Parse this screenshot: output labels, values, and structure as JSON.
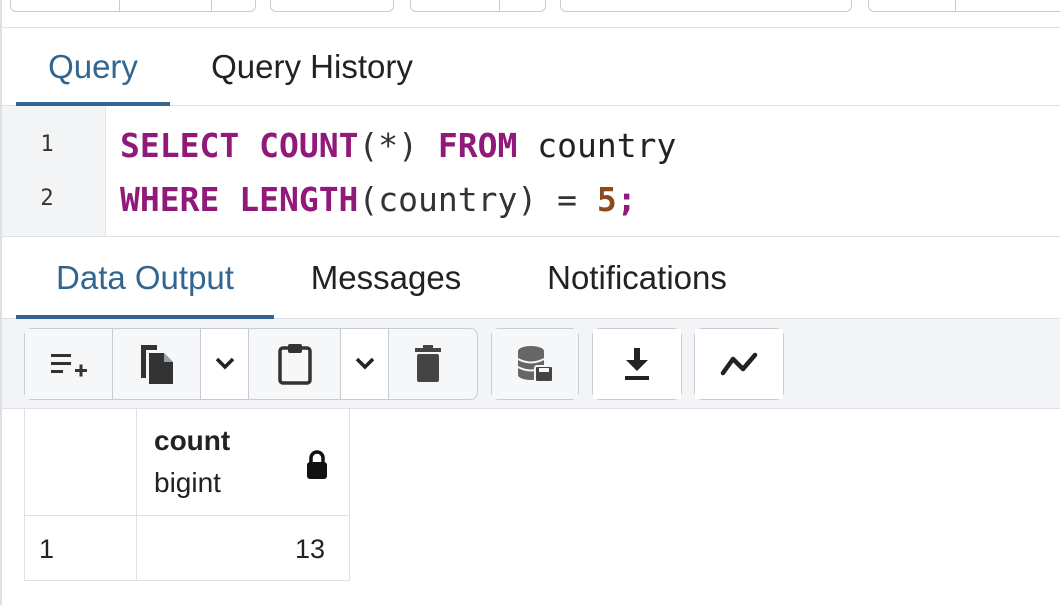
{
  "query_tabs": [
    {
      "label": "Query",
      "active": true
    },
    {
      "label": "Query History",
      "active": false
    }
  ],
  "editor": {
    "lines": [
      {
        "number": "1",
        "tokens": {
          "t1": "SELECT",
          "t2": " ",
          "t3": "COUNT",
          "t4": "(*)",
          "t5": " ",
          "t6": "FROM",
          "t7": " country"
        }
      },
      {
        "number": "2",
        "tokens": {
          "t1": "WHERE",
          "t2": " ",
          "t3": "LENGTH",
          "t4": "(country) = ",
          "t5": "5",
          "t6": ";"
        }
      }
    ]
  },
  "output_tabs": [
    {
      "label": "Data Output",
      "active": true
    },
    {
      "label": "Messages",
      "active": false
    },
    {
      "label": "Notifications",
      "active": false
    }
  ],
  "grid_toolbar": {
    "buttons": [
      {
        "icon": "add-row-icon"
      },
      {
        "icon": "copy-icon"
      },
      {
        "icon": "chevron-down-icon"
      },
      {
        "icon": "paste-icon"
      },
      {
        "icon": "chevron-down-icon"
      },
      {
        "icon": "delete-icon"
      },
      {
        "icon": "save-data-icon"
      },
      {
        "icon": "download-icon"
      },
      {
        "icon": "graph-icon"
      }
    ]
  },
  "result_grid": {
    "columns": [
      {
        "name": "count",
        "type": "bigint",
        "locked": true
      }
    ],
    "rows": [
      {
        "row_number": "1",
        "values": [
          "13"
        ]
      }
    ]
  },
  "colors": {
    "accent": "#326690",
    "keyword": "#90197a",
    "number": "#8a4a1b"
  }
}
